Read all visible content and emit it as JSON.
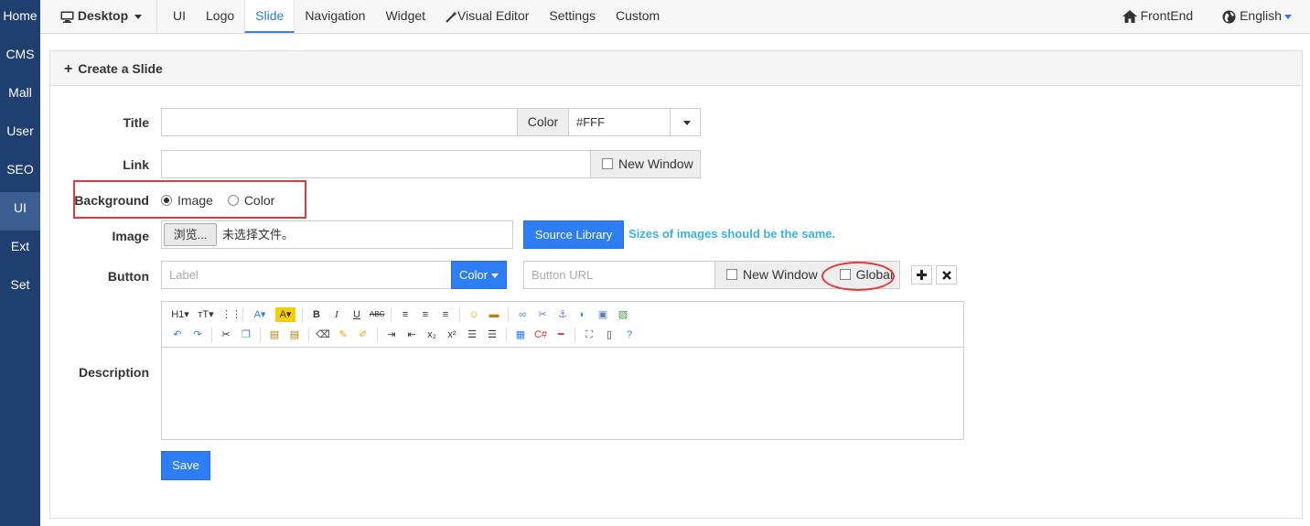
{
  "sidebar": {
    "items": [
      {
        "label": "Home",
        "active": false
      },
      {
        "label": "CMS",
        "active": false
      },
      {
        "label": "Mall",
        "active": false
      },
      {
        "label": "User",
        "active": false
      },
      {
        "label": "SEO",
        "active": false
      },
      {
        "label": "UI",
        "active": true
      },
      {
        "label": "Ext",
        "active": false
      },
      {
        "label": "Set",
        "active": false
      }
    ]
  },
  "topnav": {
    "desktop_label": "Desktop",
    "tabs": [
      {
        "label": "UI",
        "active": false
      },
      {
        "label": "Logo",
        "active": false
      },
      {
        "label": "Slide",
        "active": true
      },
      {
        "label": "Navigation",
        "active": false
      },
      {
        "label": "Widget",
        "active": false
      },
      {
        "label": "Visual Editor",
        "active": false
      },
      {
        "label": "Settings",
        "active": false
      },
      {
        "label": "Custom",
        "active": false
      }
    ],
    "frontend_label": "FrontEnd",
    "language_label": "English"
  },
  "panel": {
    "title": "Create a Slide"
  },
  "form": {
    "title_label": "Title",
    "title_value": "",
    "color_addon": "Color",
    "color_value": "#FFF",
    "link_label": "Link",
    "link_value": "",
    "new_window_label": "New Window",
    "background_label": "Background",
    "bg_option_image": "Image",
    "bg_option_color": "Color",
    "image_label": "Image",
    "browse_button": "浏览...",
    "no_file_text": "未选择文件。",
    "source_library_button": "Source Library",
    "image_hint": "Sizes of images should be the same.",
    "button_label": "Button",
    "button_label_placeholder": "Label",
    "color_button": "Color",
    "button_url_placeholder": "Button URL",
    "button_new_window_label": "New Window",
    "global_label": "Global",
    "description_label": "Description",
    "save_button": "Save"
  },
  "colors": {
    "sidebar_bg": "#1f3f70",
    "accent_blue": "#2d7df5",
    "hint_text": "#3bb3d6",
    "annotation_red": "#e23a3a"
  }
}
